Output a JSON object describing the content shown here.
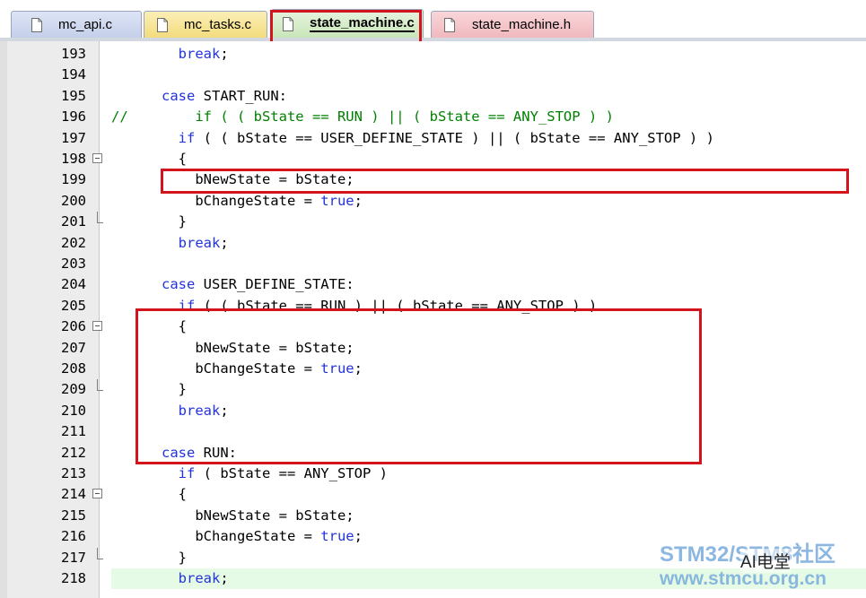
{
  "tabs": [
    {
      "label": "mc_api.c",
      "active": false,
      "color": "#c4cfea"
    },
    {
      "label": "mc_tasks.c",
      "active": false,
      "color": "#f3dc7e"
    },
    {
      "label": "state_machine.c",
      "active": true,
      "color": "#c8e6b8"
    },
    {
      "label": "state_machine.h",
      "active": false,
      "color": "#f0b9be"
    }
  ],
  "editor": {
    "lines": [
      {
        "num": "193",
        "code": "        break;"
      },
      {
        "num": "194",
        "code": ""
      },
      {
        "num": "195",
        "code": "      case START_RUN:"
      },
      {
        "num": "196",
        "code": "//        if ( ( bState == RUN ) || ( bState == ANY_STOP ) )"
      },
      {
        "num": "197",
        "code": "        if ( ( bState == USER_DEFINE_STATE ) || ( bState == ANY_STOP ) )"
      },
      {
        "num": "198",
        "code": "        {"
      },
      {
        "num": "199",
        "code": "          bNewState = bState;"
      },
      {
        "num": "200",
        "code": "          bChangeState = true;"
      },
      {
        "num": "201",
        "code": "        }"
      },
      {
        "num": "202",
        "code": "        break;"
      },
      {
        "num": "203",
        "code": ""
      },
      {
        "num": "204",
        "code": "      case USER_DEFINE_STATE:"
      },
      {
        "num": "205",
        "code": "        if ( ( bState == RUN ) || ( bState == ANY_STOP ) )"
      },
      {
        "num": "206",
        "code": "        {"
      },
      {
        "num": "207",
        "code": "          bNewState = bState;"
      },
      {
        "num": "208",
        "code": "          bChangeState = true;"
      },
      {
        "num": "209",
        "code": "        }"
      },
      {
        "num": "210",
        "code": "        break;"
      },
      {
        "num": "211",
        "code": ""
      },
      {
        "num": "212",
        "code": "      case RUN:"
      },
      {
        "num": "213",
        "code": "        if ( bState == ANY_STOP )"
      },
      {
        "num": "214",
        "code": "        {"
      },
      {
        "num": "215",
        "code": "          bNewState = bState;"
      },
      {
        "num": "216",
        "code": "          bChangeState = true;"
      },
      {
        "num": "217",
        "code": "        }"
      },
      {
        "num": "218",
        "code": "        break;"
      }
    ]
  },
  "watermark": {
    "line1": "STM32/STM8社区",
    "line2": "www.stmcu.org.cn",
    "badge": "AI电堂"
  },
  "colors": {
    "highlight_red": "#d4141d",
    "keyword_blue": "#2233dd",
    "comment_green": "#008000",
    "current_line_bg": "#e5fbe5"
  }
}
